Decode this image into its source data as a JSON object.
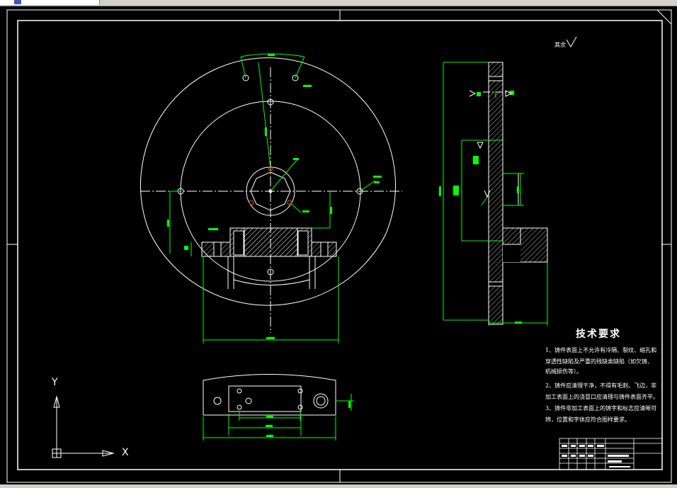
{
  "window": {
    "tab_icon": "drawing-file-icon"
  },
  "drawing": {
    "background": "#000000",
    "line_color": "#ffffff",
    "dimension_color": "#00ff00",
    "center_mark_color": "#ff0000",
    "hatch_color": "#ffffff"
  },
  "technical_requirements": {
    "title": "技术要求",
    "items": [
      "1、铸件表面上不允许有冷隔、裂纹、缩孔和",
      "穿透性缺陷及严重的残缺类缺陷（如欠铸、",
      "机械损伤等）。",
      "2、铸件应清理干净，不得有毛刺、飞边，非",
      "加工表面上的浇冒口应清理与铸件表面齐平。",
      "3、铸件非加工表面上的铸字和标志应清晰可",
      "辨，位置和字体应符合图样要求。"
    ]
  },
  "roughness_note": "其余",
  "ucs": {
    "y_label": "Y",
    "x_label": "X"
  }
}
